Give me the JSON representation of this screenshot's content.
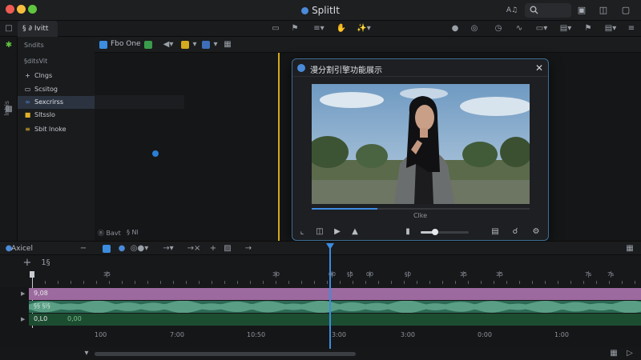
{
  "app": {
    "title": "SplitIt"
  },
  "titlebar": {
    "search_placeholder": "",
    "lang_label": "A♫"
  },
  "sidebar": {
    "tab_label": "§ ∂ Ivitt",
    "vertical_label": "lnbis",
    "section1": "Sndits",
    "section2": "§ditsVit",
    "items": [
      {
        "icon": "plus-icon",
        "glyph": "+",
        "label": "Clngs"
      },
      {
        "icon": "film-icon",
        "glyph": "▭",
        "label": "Scsitog"
      },
      {
        "icon": "link-icon",
        "glyph": "∞",
        "label": "Sexcrirss"
      },
      {
        "icon": "folder-icon",
        "glyph": "■",
        "label": "Sltsslo"
      },
      {
        "icon": "list-icon",
        "glyph": "≡",
        "label": "Sbit lnoke"
      }
    ],
    "active_index": 2
  },
  "viewer": {
    "project_label": "Fbo One",
    "status_left": "Ⓑ Bavt",
    "status_right": "§ Nl"
  },
  "dialog": {
    "title": "漫分割引擎功能展示",
    "subtitle": "Clke",
    "progress": 0.3
  },
  "volume": {
    "level": 0.3
  },
  "timeline": {
    "panel_title": "Axicel",
    "track_count": "1§",
    "ruler_ticks": [
      "35",
      "30",
      "00",
      "§5",
      "00",
      "§0",
      "35",
      "35",
      "7s",
      "7s"
    ],
    "bottom_ticks": [
      "100",
      "7:00",
      "10:50",
      "3:00",
      "3:00",
      "0:00",
      "1:00"
    ],
    "tracks": [
      {
        "label": "9,08",
        "color": "#9c6a9e"
      },
      {
        "label": "",
        "color": "#2c6a55"
      },
      {
        "label": "0,L0",
        "color": "#1d4d31"
      }
    ],
    "clip2_label": "0,00",
    "audio_label": "§§ §l§"
  },
  "colors": {
    "accent": "#3c8ce0",
    "playhead": "#d4aa1e",
    "video_track": "#9c6a9e",
    "audio_track": "#2c6a55",
    "track3": "#1d4d31"
  }
}
